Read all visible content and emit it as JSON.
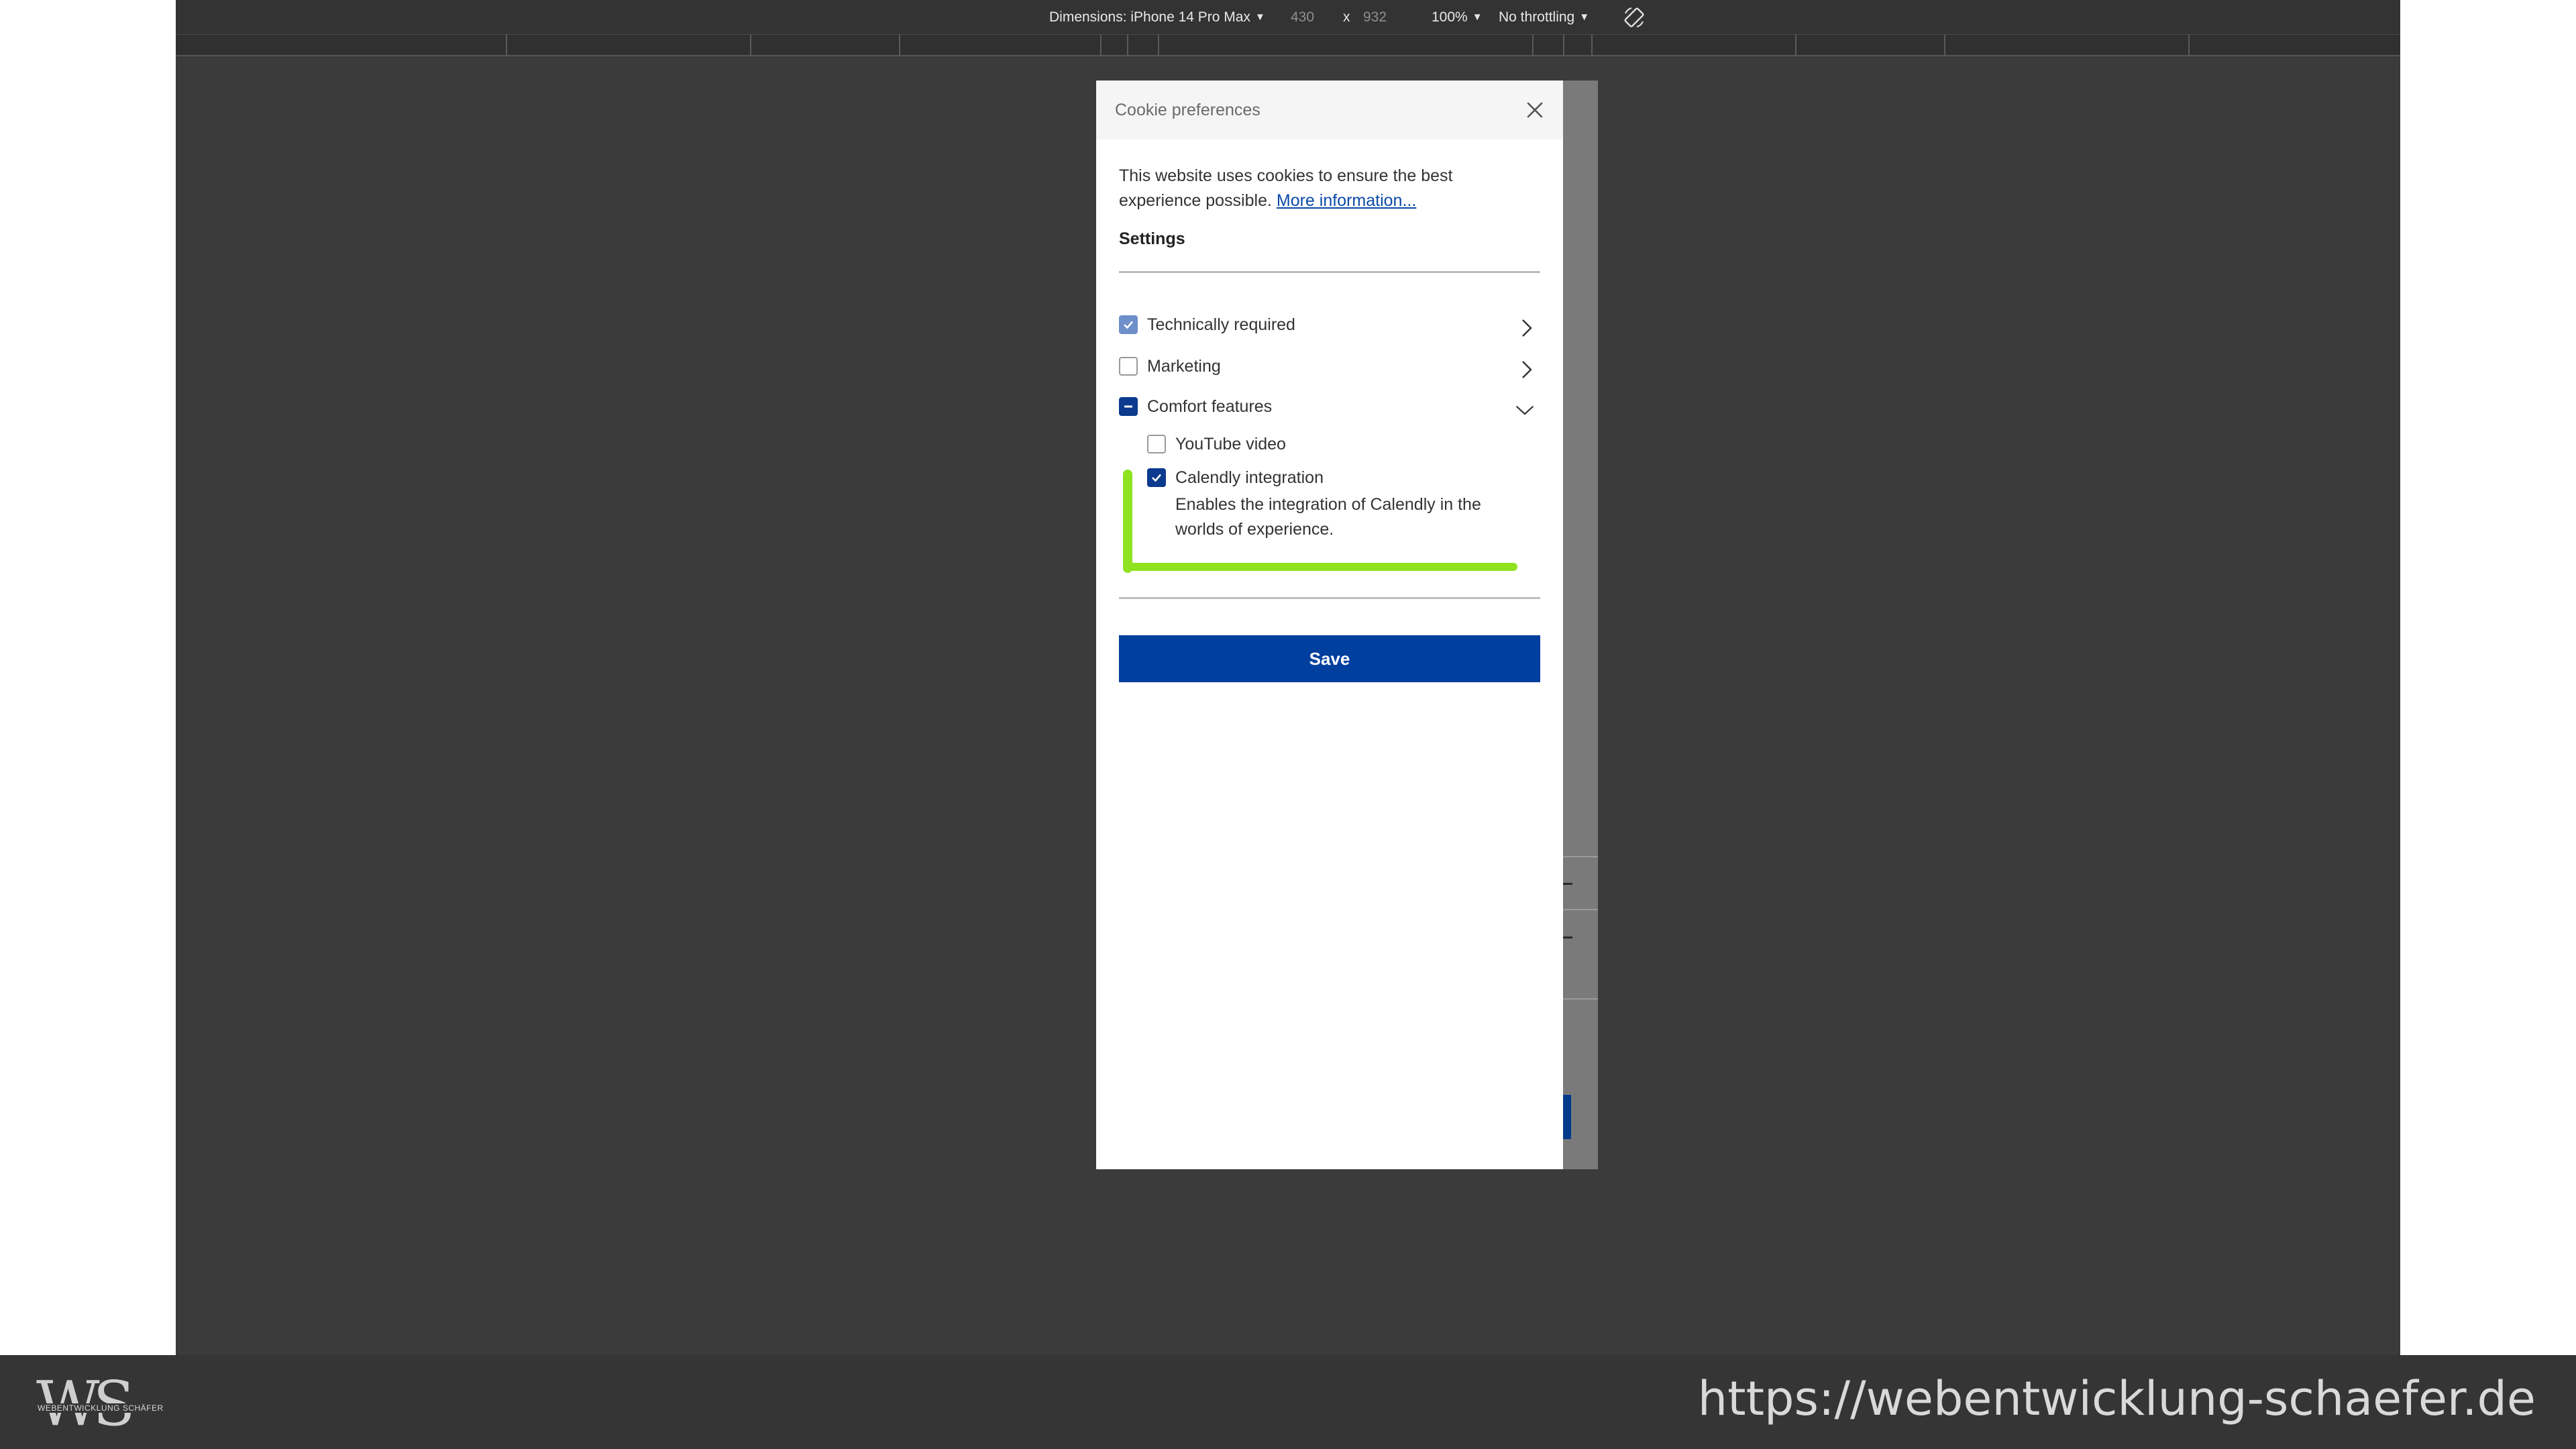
{
  "devtools": {
    "dimensions_label": "Dimensions: iPhone 14 Pro Max",
    "width_value": "430",
    "times": "x",
    "height_value": "932",
    "zoom": "100%",
    "throttling": "No throttling",
    "caret": "▼",
    "rotate_icon": "rotate-icon"
  },
  "modal": {
    "title": "Cookie preferences",
    "intro_text": "This website uses cookies to ensure the best experience possible.",
    "more_info_link": "More information...",
    "settings_heading": "Settings",
    "categories": [
      {
        "label": "Technically required",
        "checked": true,
        "expanded": false
      },
      {
        "label": "Marketing",
        "checked": false,
        "expanded": false
      },
      {
        "label": "Comfort features",
        "checked": "partial",
        "expanded": true
      }
    ],
    "sub_items": [
      {
        "label": "YouTube video",
        "checked": false
      },
      {
        "label": "Calendly integration",
        "checked": true
      }
    ],
    "calendly_description": "Enables the integration of Calendly in the worlds of experience.",
    "save_label": "Save"
  },
  "footer": {
    "logo_letters": "WS",
    "logo_subtitle": "WEBENTWICKLUNG SCHÄFER",
    "url": "https://webentwicklung-schaefer.de"
  },
  "colors": {
    "primary_blue": "#003f9e",
    "highlight_green": "#8ee21e",
    "devtools_bg": "#3b3b3b"
  }
}
